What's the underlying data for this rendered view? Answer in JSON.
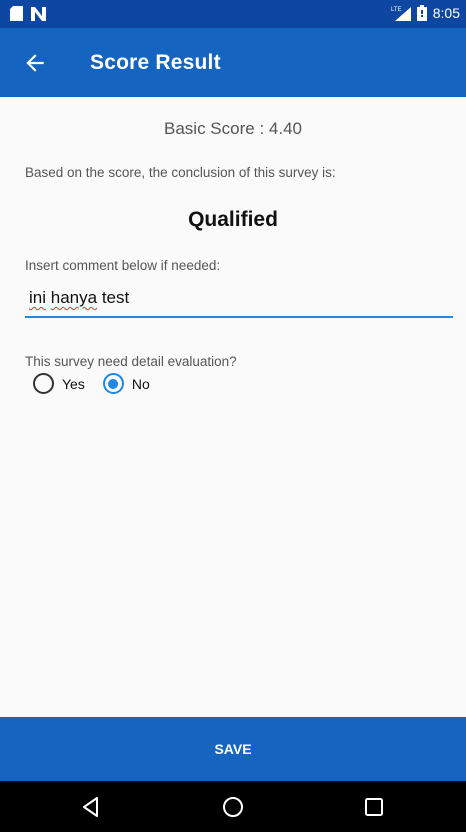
{
  "status_bar": {
    "time": "8:05",
    "left_icons": [
      "sd-card-icon",
      "n-icon"
    ],
    "right_icons": [
      "lte-signal-icon",
      "battery-icon"
    ]
  },
  "app_bar": {
    "title": "Score Result",
    "back_icon": "arrow-left-icon",
    "color": "#1565c0"
  },
  "content": {
    "basic_score": "Basic Score : 4.40",
    "conclusion_text": "Based on the score, the conclusion of this survey is:",
    "result": "Qualified",
    "comment_label": "Insert comment below if needed:",
    "comment_value_words": [
      "ini",
      "hanya",
      "test"
    ],
    "evaluation_question": "This survey need detail evaluation?",
    "options": [
      {
        "label": "Yes",
        "selected": false
      },
      {
        "label": "No",
        "selected": true
      }
    ]
  },
  "save_button": {
    "label": "SAVE"
  },
  "nav_bar": {
    "buttons": [
      "back-triangle-icon",
      "home-circle-icon",
      "recents-square-icon"
    ]
  }
}
